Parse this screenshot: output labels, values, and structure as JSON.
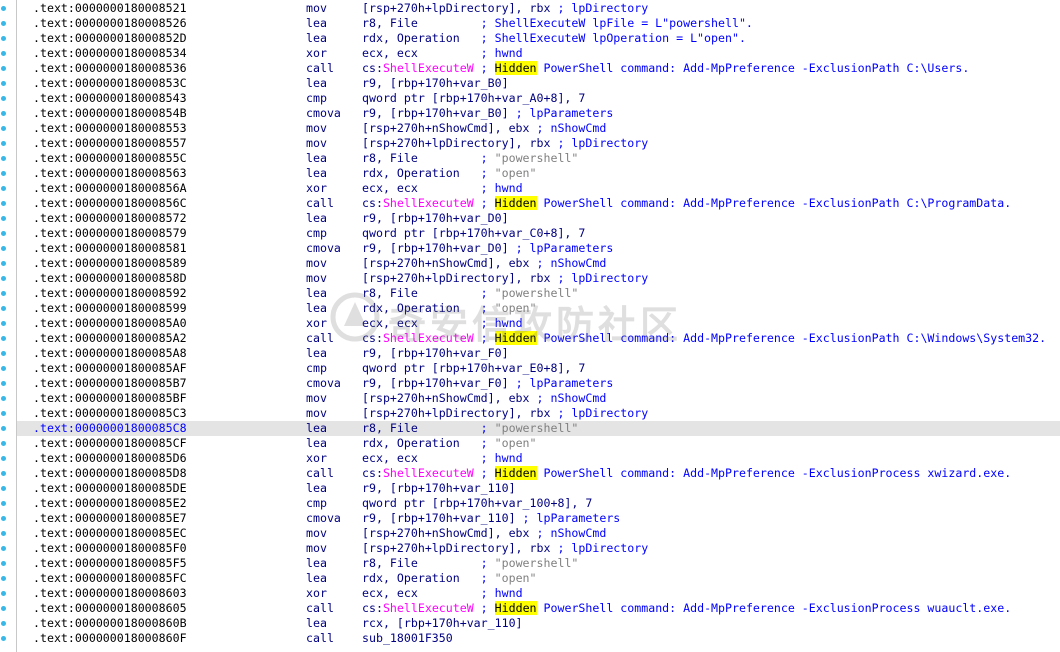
{
  "watermark": {
    "text": "奇安信攻防社区"
  },
  "rows": [
    {
      "addr": ".text:0000000180008521",
      "mnem": "mov",
      "pre": "[rsp+270h+lpDirectory], rbx",
      "sep": " ; ",
      "comment": "lpDirectory"
    },
    {
      "addr": ".text:0000000180008526",
      "mnem": "lea",
      "pre": "r8, File        ",
      "sep": " ; ",
      "comment": "ShellExecuteW lpFile = L\"powershell\"."
    },
    {
      "addr": ".text:000000018000852D",
      "mnem": "lea",
      "pre": "rdx, Operation  ",
      "sep": " ; ",
      "comment": "ShellExecuteW lpOperation = L\"open\"."
    },
    {
      "addr": ".text:0000000180008534",
      "mnem": "xor",
      "pre": "ecx, ecx        ",
      "sep": " ; ",
      "comment": "hwnd"
    },
    {
      "addr": ".text:0000000180008536",
      "mnem": "call",
      "pre": "cs:",
      "imp": "ShellExecuteW",
      "sep": " ; ",
      "hl": "Hidden",
      "comment": " PowerShell command: Add-MpPreference -ExclusionPath C:\\Users."
    },
    {
      "addr": ".text:000000018000853C",
      "mnem": "lea",
      "pre": "r9, [rbp+170h+var_B0]"
    },
    {
      "addr": ".text:0000000180008543",
      "mnem": "cmp",
      "pre": "qword ptr [rbp+170h+var_A0+8], 7"
    },
    {
      "addr": ".text:000000018000854B",
      "mnem": "cmova",
      "pre": "r9, [rbp+170h+var_B0]",
      "sep": " ; ",
      "comment": "lpParameters"
    },
    {
      "addr": ".text:0000000180008553",
      "mnem": "mov",
      "pre": "[rsp+270h+nShowCmd], ebx",
      "sep": " ; ",
      "comment": "nShowCmd"
    },
    {
      "addr": ".text:0000000180008557",
      "mnem": "mov",
      "pre": "[rsp+270h+lpDirectory], rbx",
      "sep": " ; ",
      "comment": "lpDirectory"
    },
    {
      "addr": ".text:000000018000855C",
      "mnem": "lea",
      "pre": "r8, File        ",
      "sep": " ; ",
      "str": "\"powershell\""
    },
    {
      "addr": ".text:0000000180008563",
      "mnem": "lea",
      "pre": "rdx, Operation  ",
      "sep": " ; ",
      "str": "\"open\""
    },
    {
      "addr": ".text:000000018000856A",
      "mnem": "xor",
      "pre": "ecx, ecx        ",
      "sep": " ; ",
      "comment": "hwnd"
    },
    {
      "addr": ".text:000000018000856C",
      "mnem": "call",
      "pre": "cs:",
      "imp": "ShellExecuteW",
      "sep": " ; ",
      "hl": "Hidden",
      "comment": " PowerShell command: Add-MpPreference -ExclusionPath C:\\ProgramData."
    },
    {
      "addr": ".text:0000000180008572",
      "mnem": "lea",
      "pre": "r9, [rbp+170h+var_D0]"
    },
    {
      "addr": ".text:0000000180008579",
      "mnem": "cmp",
      "pre": "qword ptr [rbp+170h+var_C0+8], 7"
    },
    {
      "addr": ".text:0000000180008581",
      "mnem": "cmova",
      "pre": "r9, [rbp+170h+var_D0]",
      "sep": " ; ",
      "comment": "lpParameters"
    },
    {
      "addr": ".text:0000000180008589",
      "mnem": "mov",
      "pre": "[rsp+270h+nShowCmd], ebx",
      "sep": " ; ",
      "comment": "nShowCmd"
    },
    {
      "addr": ".text:000000018000858D",
      "mnem": "mov",
      "pre": "[rsp+270h+lpDirectory], rbx",
      "sep": " ; ",
      "comment": "lpDirectory"
    },
    {
      "addr": ".text:0000000180008592",
      "mnem": "lea",
      "pre": "r8, File        ",
      "sep": " ; ",
      "str": "\"powershell\""
    },
    {
      "addr": ".text:0000000180008599",
      "mnem": "lea",
      "pre": "rdx, Operation  ",
      "sep": " ; ",
      "str": "\"open\""
    },
    {
      "addr": ".text:00000001800085A0",
      "mnem": "xor",
      "pre": "ecx, ecx        ",
      "sep": " ; ",
      "comment": "hwnd"
    },
    {
      "addr": ".text:00000001800085A2",
      "mnem": "call",
      "pre": "cs:",
      "imp": "ShellExecuteW",
      "sep": " ; ",
      "hl": "Hidden",
      "comment": " PowerShell command: Add-MpPreference -ExclusionPath C:\\Windows\\System32."
    },
    {
      "addr": ".text:00000001800085A8",
      "mnem": "lea",
      "pre": "r9, [rbp+170h+var_F0]"
    },
    {
      "addr": ".text:00000001800085AF",
      "mnem": "cmp",
      "pre": "qword ptr [rbp+170h+var_E0+8], 7"
    },
    {
      "addr": ".text:00000001800085B7",
      "mnem": "cmova",
      "pre": "r9, [rbp+170h+var_F0]",
      "sep": " ; ",
      "comment": "lpParameters"
    },
    {
      "addr": ".text:00000001800085BF",
      "mnem": "mov",
      "pre": "[rsp+270h+nShowCmd], ebx",
      "sep": " ; ",
      "comment": "nShowCmd"
    },
    {
      "addr": ".text:00000001800085C3",
      "mnem": "mov",
      "pre": "[rsp+270h+lpDirectory], rbx",
      "sep": " ; ",
      "comment": "lpDirectory"
    },
    {
      "addr": ".text:00000001800085C8",
      "mnem": "lea",
      "pre": "r8, File        ",
      "sep": " ; ",
      "str": "\"powershell\"",
      "current": true
    },
    {
      "addr": ".text:00000001800085CF",
      "mnem": "lea",
      "pre": "rdx, Operation  ",
      "sep": " ; ",
      "str": "\"open\""
    },
    {
      "addr": ".text:00000001800085D6",
      "mnem": "xor",
      "pre": "ecx, ecx        ",
      "sep": " ; ",
      "comment": "hwnd"
    },
    {
      "addr": ".text:00000001800085D8",
      "mnem": "call",
      "pre": "cs:",
      "imp": "ShellExecuteW",
      "sep": " ; ",
      "hl": "Hidden",
      "comment": " PowerShell command: Add-MpPreference -ExclusionProcess xwizard.exe."
    },
    {
      "addr": ".text:00000001800085DE",
      "mnem": "lea",
      "pre": "r9, [rbp+170h+var_110]"
    },
    {
      "addr": ".text:00000001800085E2",
      "mnem": "cmp",
      "pre": "qword ptr [rbp+170h+var_100+8], 7"
    },
    {
      "addr": ".text:00000001800085E7",
      "mnem": "cmova",
      "pre": "r9, [rbp+170h+var_110]",
      "sep": " ; ",
      "comment": "lpParameters"
    },
    {
      "addr": ".text:00000001800085EC",
      "mnem": "mov",
      "pre": "[rsp+270h+nShowCmd], ebx",
      "sep": " ; ",
      "comment": "nShowCmd"
    },
    {
      "addr": ".text:00000001800085F0",
      "mnem": "mov",
      "pre": "[rsp+270h+lpDirectory], rbx",
      "sep": " ; ",
      "comment": "lpDirectory"
    },
    {
      "addr": ".text:00000001800085F5",
      "mnem": "lea",
      "pre": "r8, File        ",
      "sep": " ; ",
      "str": "\"powershell\""
    },
    {
      "addr": ".text:00000001800085FC",
      "mnem": "lea",
      "pre": "rdx, Operation  ",
      "sep": " ; ",
      "str": "\"open\""
    },
    {
      "addr": ".text:0000000180008603",
      "mnem": "xor",
      "pre": "ecx, ecx        ",
      "sep": " ; ",
      "comment": "hwnd"
    },
    {
      "addr": ".text:0000000180008605",
      "mnem": "call",
      "pre": "cs:",
      "imp": "ShellExecuteW",
      "sep": " ; ",
      "hl": "Hidden",
      "comment": " PowerShell command: Add-MpPreference -ExclusionProcess wuauclt.exe."
    },
    {
      "addr": ".text:000000018000860B",
      "mnem": "lea",
      "pre": "rcx, [rbp+170h+var_110]"
    },
    {
      "addr": ".text:000000018000860F",
      "mnem": "call",
      "pre": "sub_18001F350"
    }
  ]
}
